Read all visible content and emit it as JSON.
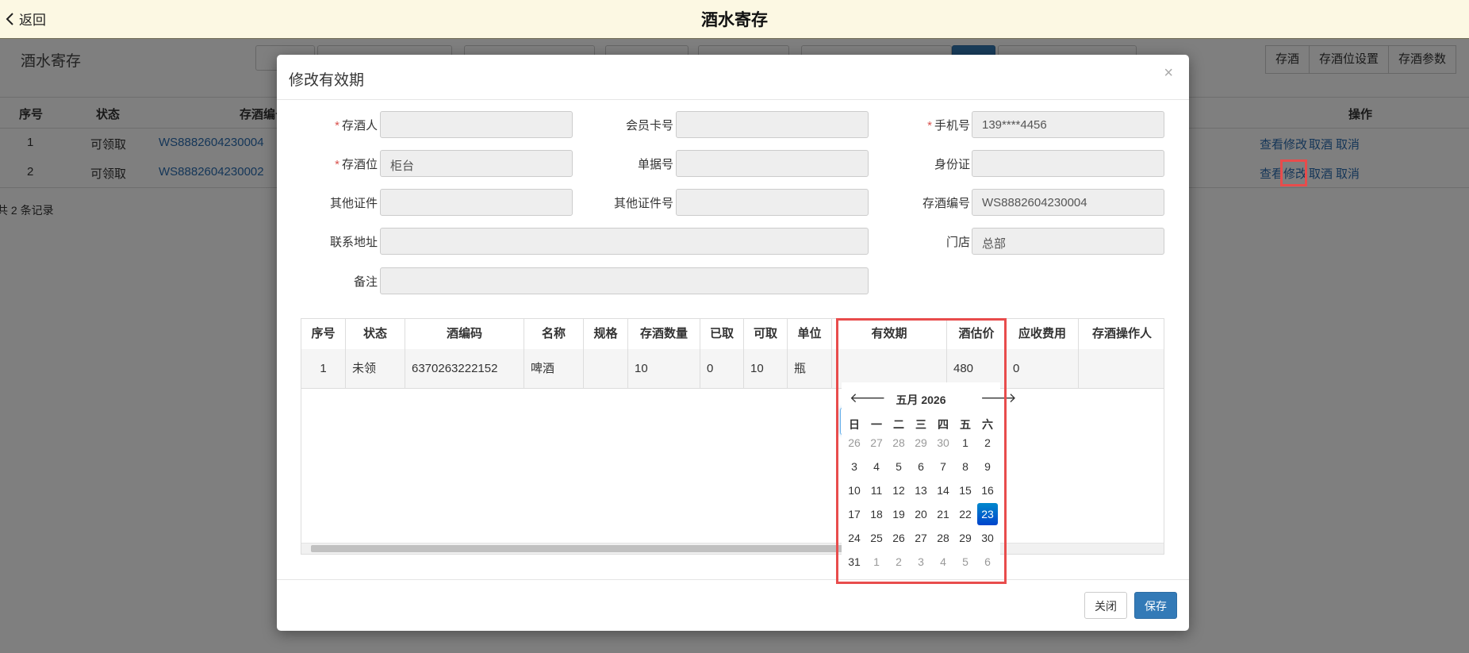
{
  "topbar": {
    "back_label": "返回",
    "title": "酒水寄存"
  },
  "page": {
    "title": "酒水寄存",
    "right_buttons": [
      "存酒",
      "存酒位设置",
      "存酒参数"
    ],
    "table": {
      "headers": {
        "seq": "序号",
        "status": "状态",
        "code": "存酒编号",
        "ops": "操作"
      },
      "rows": [
        {
          "seq": "1",
          "status": "可领取",
          "code": "WS8882604230004",
          "ops": [
            "查看",
            "修改",
            "取酒",
            "取消"
          ]
        },
        {
          "seq": "2",
          "status": "可领取",
          "code": "WS8882604230002",
          "ops": [
            "查看",
            "修改",
            "取酒",
            "取消"
          ]
        }
      ]
    },
    "records": "共 2 条记录"
  },
  "modal": {
    "title": "修改有效期",
    "close": "×",
    "fields": {
      "depositor": {
        "label": "存酒人",
        "value": ""
      },
      "member_card": {
        "label": "会员卡号",
        "value": ""
      },
      "phone": {
        "label": "手机号",
        "value": "139****4456"
      },
      "position": {
        "label": "存酒位",
        "value": "柜台"
      },
      "bill_no": {
        "label": "单据号",
        "value": ""
      },
      "id_card": {
        "label": "身份证",
        "value": ""
      },
      "other_id": {
        "label": "其他证件",
        "value": ""
      },
      "other_id_no": {
        "label": "其他证件号",
        "value": ""
      },
      "deposit_no": {
        "label": "存酒编号",
        "value": "WS8882604230004"
      },
      "address": {
        "label": "联系地址",
        "value": ""
      },
      "store": {
        "label": "门店",
        "value": "总部"
      },
      "remark": {
        "label": "备注",
        "value": ""
      }
    },
    "required_mark": "*",
    "grid": {
      "headers": [
        "序号",
        "状态",
        "酒编码",
        "名称",
        "规格",
        "存酒数量",
        "已取",
        "可取",
        "单位",
        "有效期",
        "酒估价",
        "应收费用",
        "存酒操作人"
      ],
      "row": {
        "seq": "1",
        "status": "未领",
        "code": "6370263222152",
        "name": "啤酒",
        "spec": "",
        "qty": "10",
        "taken": "0",
        "avail": "10",
        "unit": "瓶",
        "expiry": "2026-05-23",
        "price": "480",
        "fee": "0",
        "operator": ""
      }
    },
    "datepicker": {
      "month_label": "五月 2026",
      "prev": "🡐",
      "next": "🡒",
      "weekdays": [
        "日",
        "一",
        "二",
        "三",
        "四",
        "五",
        "六"
      ],
      "weeks": [
        [
          "26",
          "27",
          "28",
          "29",
          "30",
          "1",
          "2"
        ],
        [
          "3",
          "4",
          "5",
          "6",
          "7",
          "8",
          "9"
        ],
        [
          "10",
          "11",
          "12",
          "13",
          "14",
          "15",
          "16"
        ],
        [
          "17",
          "18",
          "19",
          "20",
          "21",
          "22",
          "23"
        ],
        [
          "24",
          "25",
          "26",
          "27",
          "28",
          "29",
          "30"
        ],
        [
          "31",
          "1",
          "2",
          "3",
          "4",
          "5",
          "6"
        ]
      ],
      "selected": "23"
    },
    "footer": {
      "close_label": "关闭",
      "save_label": "保存"
    }
  },
  "colors": {
    "accent": "#337ab7",
    "highlight": "#e84c4c",
    "topbar": "#fcf8e3"
  }
}
